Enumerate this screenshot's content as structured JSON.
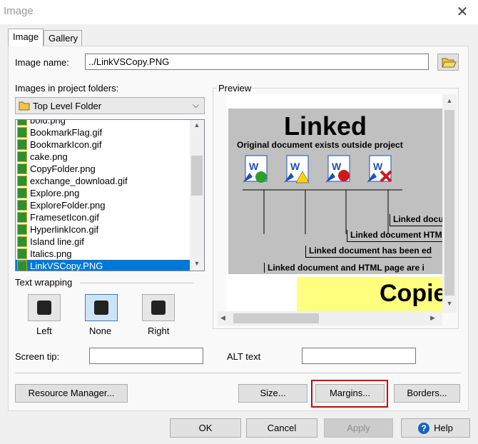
{
  "window": {
    "title": "Image",
    "close_glyph": "✕"
  },
  "tabs": [
    {
      "label": "Image",
      "active": true
    },
    {
      "label": "Gallery",
      "active": false
    }
  ],
  "image_name": {
    "label": "Image name:",
    "value": "../LinkVSCopy.PNG"
  },
  "project_folders": {
    "label": "Images in project folders:",
    "selected": "Top Level Folder",
    "items": [
      "bold.png",
      "BookmarkFlag.gif",
      "BookmarkIcon.gif",
      "cake.png",
      "CopyFolder.png",
      "exchange_download.gif",
      "Explore.png",
      "ExploreFolder.png",
      "FramesetIcon.gif",
      "HyperlinkIcon.gif",
      "Island line.gif",
      "Italics.png",
      "LinkVSCopy.PNG"
    ],
    "selected_item": "LinkVSCopy.PNG"
  },
  "text_wrapping": {
    "label": "Text wrapping",
    "options": [
      "Left",
      "None",
      "Right"
    ],
    "selected": "None"
  },
  "preview": {
    "label": "Preview",
    "heading": "Linked",
    "subheading": "Original document exists outside project",
    "lines": [
      "Linked docu",
      "Linked document HTM",
      "Linked document has been ed",
      "Linked document and HTML page are i"
    ],
    "copy_heading": "Copie"
  },
  "screen_tip": {
    "label": "Screen tip:",
    "value": ""
  },
  "alt_text": {
    "label": "ALT text",
    "value": ""
  },
  "buttons": {
    "resource_manager": "Resource Manager...",
    "size": "Size...",
    "margins": "Margins...",
    "borders": "Borders...",
    "ok": "OK",
    "cancel": "Cancel",
    "apply": "Apply",
    "help": "Help"
  },
  "colors": {
    "accent": "#0078d7",
    "highlight_box": "#d00000",
    "preview_bg": "#c0c0c0",
    "copy_bg": "#ffff80"
  }
}
